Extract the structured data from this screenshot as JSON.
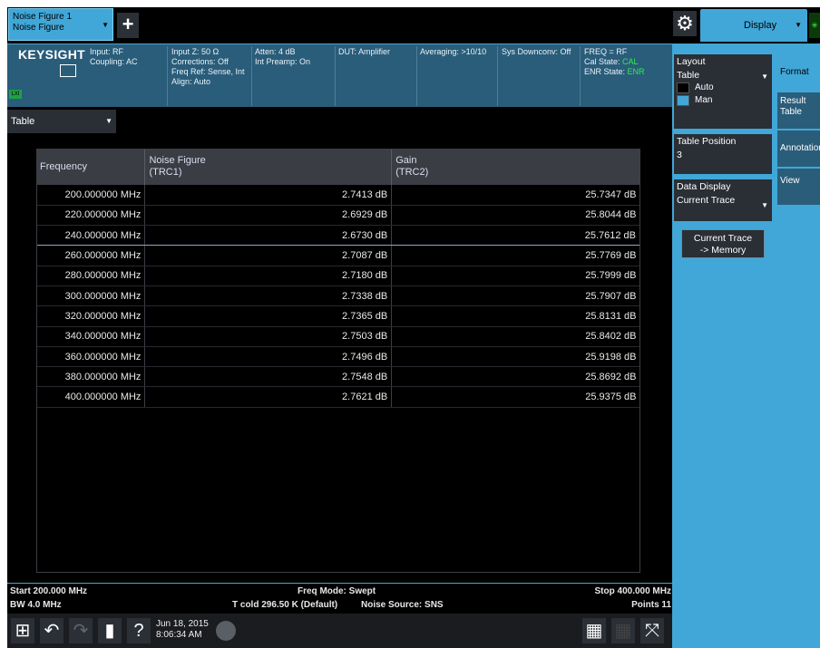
{
  "top_bar": {
    "mode_tab_line1": "Noise Figure 1",
    "mode_tab_line2": "Noise Figure",
    "add_symbol": "+",
    "display_tab": "Display"
  },
  "settings_bar": {
    "brand": "KEYSIGHT",
    "lxi": "LXI",
    "col1": [
      "Input: RF",
      "Coupling: AC"
    ],
    "col2": [
      "Input Z: 50 Ω",
      "Corrections: Off",
      "Freq Ref: Sense, Int",
      "Align: Auto"
    ],
    "col3": [
      "Atten: 4 dB",
      "Int Preamp: On"
    ],
    "col4": [
      "DUT: Amplifier"
    ],
    "col5": [
      "Averaging: >10/10"
    ],
    "col6": [
      "Sys Downconv: Off"
    ],
    "col7": {
      "freq": "FREQ = RF",
      "cal_label": "Cal State:",
      "cal_value": "CAL",
      "enr_label": "ENR State:",
      "enr_value": "ENR"
    }
  },
  "view": {
    "dropdown": "Table"
  },
  "table": {
    "headers": {
      "frequency": "Frequency",
      "nf_line1": "Noise Figure",
      "nf_line2": "(TRC1)",
      "gain_line1": "Gain",
      "gain_line2": "(TRC2)"
    },
    "selected_row": 2,
    "rows": [
      {
        "freq": "200.000000 MHz",
        "nf": "2.7413 dB",
        "gain": "25.7347 dB"
      },
      {
        "freq": "220.000000 MHz",
        "nf": "2.6929 dB",
        "gain": "25.8044 dB"
      },
      {
        "freq": "240.000000 MHz",
        "nf": "2.6730 dB",
        "gain": "25.7612 dB"
      },
      {
        "freq": "260.000000 MHz",
        "nf": "2.7087 dB",
        "gain": "25.7769 dB"
      },
      {
        "freq": "280.000000 MHz",
        "nf": "2.7180 dB",
        "gain": "25.7999 dB"
      },
      {
        "freq": "300.000000 MHz",
        "nf": "2.7338 dB",
        "gain": "25.7907 dB"
      },
      {
        "freq": "320.000000 MHz",
        "nf": "2.7365 dB",
        "gain": "25.8131 dB"
      },
      {
        "freq": "340.000000 MHz",
        "nf": "2.7503 dB",
        "gain": "25.8402 dB"
      },
      {
        "freq": "360.000000 MHz",
        "nf": "2.7496 dB",
        "gain": "25.9198 dB"
      },
      {
        "freq": "380.000000 MHz",
        "nf": "2.7548 dB",
        "gain": "25.8692 dB"
      },
      {
        "freq": "400.000000 MHz",
        "nf": "2.7621 dB",
        "gain": "25.9375 dB"
      }
    ]
  },
  "status": {
    "start": "Start 200.000 MHz",
    "bw": "BW 4.0 MHz",
    "freq_mode": "Freq Mode: Swept",
    "tcold": "T cold 296.50 K (Default)",
    "noise_source": "Noise Source: SNS",
    "stop": "Stop 400.000 MHz",
    "points": "Points 11"
  },
  "taskbar": {
    "date": "Jun 18, 2015",
    "time": "8:06:34 AM"
  },
  "right_panel": {
    "layout_label": "Layout",
    "layout_value": "Table",
    "auto": "Auto",
    "man": "Man",
    "table_position_label": "Table Position",
    "table_position_value": "3",
    "data_display_label": "Data Display",
    "data_display_value": "Current Trace",
    "memory_button": [
      "Current Trace",
      "-> Memory"
    ],
    "tabs": [
      "Format",
      "Result Table",
      "Annotation",
      "View"
    ]
  },
  "colors": {
    "accent": "#41a7d8",
    "settings_bg": "#2a5d7a",
    "status_green": "#2ef04a"
  }
}
